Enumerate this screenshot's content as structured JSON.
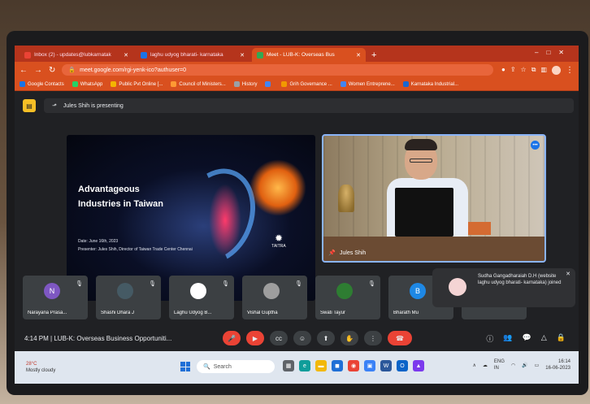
{
  "browser": {
    "tabs": [
      {
        "label": "Inbox (2) - updates@lubkarnatak",
        "color": "#ea4335",
        "active": false
      },
      {
        "label": "laghu udyog bharati- karnataka",
        "color": "#1a73e8",
        "active": false
      },
      {
        "label": "Meet - LUB-K: Overseas Bus",
        "color": "#34a853",
        "active": true
      }
    ],
    "new_tab": "+",
    "url": "meet.google.com/rgi-yenk-ico?authuser=0",
    "bookmarks": [
      {
        "label": "Google Contacts",
        "color": "#1a73e8"
      },
      {
        "label": "WhatsApp",
        "color": "#25d366"
      },
      {
        "label": "Public Pvt Online [...",
        "color": "#f4b400"
      },
      {
        "label": "Council of Ministers...",
        "color": "#ff9933"
      },
      {
        "label": "History",
        "color": "#9aa0a6"
      },
      {
        "label": "",
        "color": "#4285f4"
      },
      {
        "label": "Grih Governance ...",
        "color": "#f29900"
      },
      {
        "label": "Women Entreprene...",
        "color": "#4285f4"
      },
      {
        "label": "Karnataka Industrial...",
        "color": "#1967d2"
      }
    ]
  },
  "meet": {
    "presenting_text": "Jules Shih is presenting",
    "slide": {
      "title_line1": "Advantageous",
      "title_line2": "Industries in Taiwan",
      "date": "Date: June 16th, 2023",
      "presenter": "Presenter: Jules Shih, Director of Taiwan Trade Center Chennai",
      "logo_text": "TAITRA"
    },
    "camera": {
      "name": "Jules Shih"
    },
    "participants": [
      {
        "name": "Narayana Prasa...",
        "initial": "N",
        "color": "#7e57c2"
      },
      {
        "name": "Shashi Dhara J",
        "initial": "",
        "color": "#455a64"
      },
      {
        "name": "Laghu Udyog B...",
        "initial": "",
        "color": "#ffffff"
      },
      {
        "name": "Vishal Guptha",
        "initial": "",
        "color": "#9e9e9e"
      },
      {
        "name": "Swati Tayur",
        "initial": "",
        "color": "#2e7d32"
      },
      {
        "name": "Bharath Mu",
        "initial": "B",
        "color": "#1e88e5"
      },
      {
        "name": "",
        "initial": "",
        "color": "#3c4043"
      }
    ],
    "notification": "Sudha Gangadharaiah D.H (website laghu udyog bharati- karnataka) joined",
    "time": "4:14 PM",
    "meeting_title": "LUB-K: Overseas Business Opportuniti...",
    "controls": [
      "mic",
      "camera",
      "captions",
      "emoji",
      "present",
      "raise-hand",
      "more"
    ]
  },
  "taskbar": {
    "weather_temp": "28°C",
    "weather_desc": "Mostly cloudy",
    "search_placeholder": "Search",
    "lang": "ENG",
    "lang2": "IN",
    "time": "16:14",
    "date": "16-06-2023"
  }
}
